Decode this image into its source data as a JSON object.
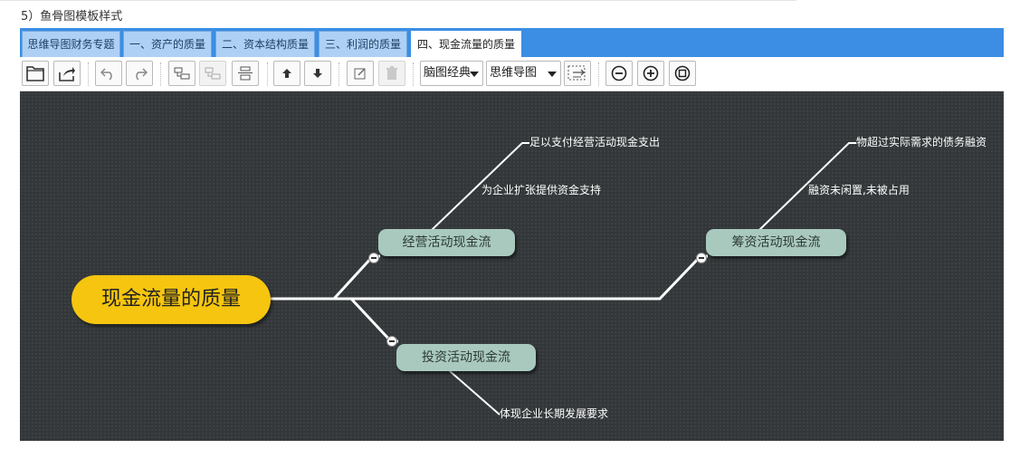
{
  "caption": "5）鱼骨图模板样式",
  "tabs": [
    {
      "label": "思维导图财务专题"
    },
    {
      "label": "一、资产的质量"
    },
    {
      "label": "二、资本结构质量"
    },
    {
      "label": "三、利润的质量"
    },
    {
      "label": "四、现金流量的质量"
    }
  ],
  "active_tab": "四、现金流量的质量",
  "toolbar": {
    "theme_select": "脑图经典",
    "layout_select": "思维导图",
    "icons": [
      "open-icon",
      "export-icon",
      "undo-icon",
      "redo-icon",
      "insert-child-icon",
      "insert-sibling-icon",
      "insert-parent-icon",
      "move-up-icon",
      "move-down-icon",
      "edit-icon",
      "delete-icon",
      "expand-level-icon",
      "zoom-out-icon",
      "zoom-in-icon",
      "fit-view-icon"
    ]
  },
  "mindmap": {
    "root": "现金流量的质量",
    "branches": {
      "operating": {
        "label": "经营活动现金流",
        "leaves": [
          "足以支付经营活动现金支出",
          "为企业扩张提供资金支持"
        ]
      },
      "financing": {
        "label": "筹资活动现金流",
        "leaves": [
          "物超过实际需求的债务融资",
          "融资未闲置,未被占用"
        ]
      },
      "investing": {
        "label": "投资活动现金流",
        "leaves": [
          "体现企业长期发展要求"
        ]
      }
    }
  },
  "colors": {
    "tabbar": "#3b8ee4",
    "canvas": "#333739",
    "root": "#f5c50f",
    "branch": "#a9c9bf",
    "line": "#ffffff"
  }
}
